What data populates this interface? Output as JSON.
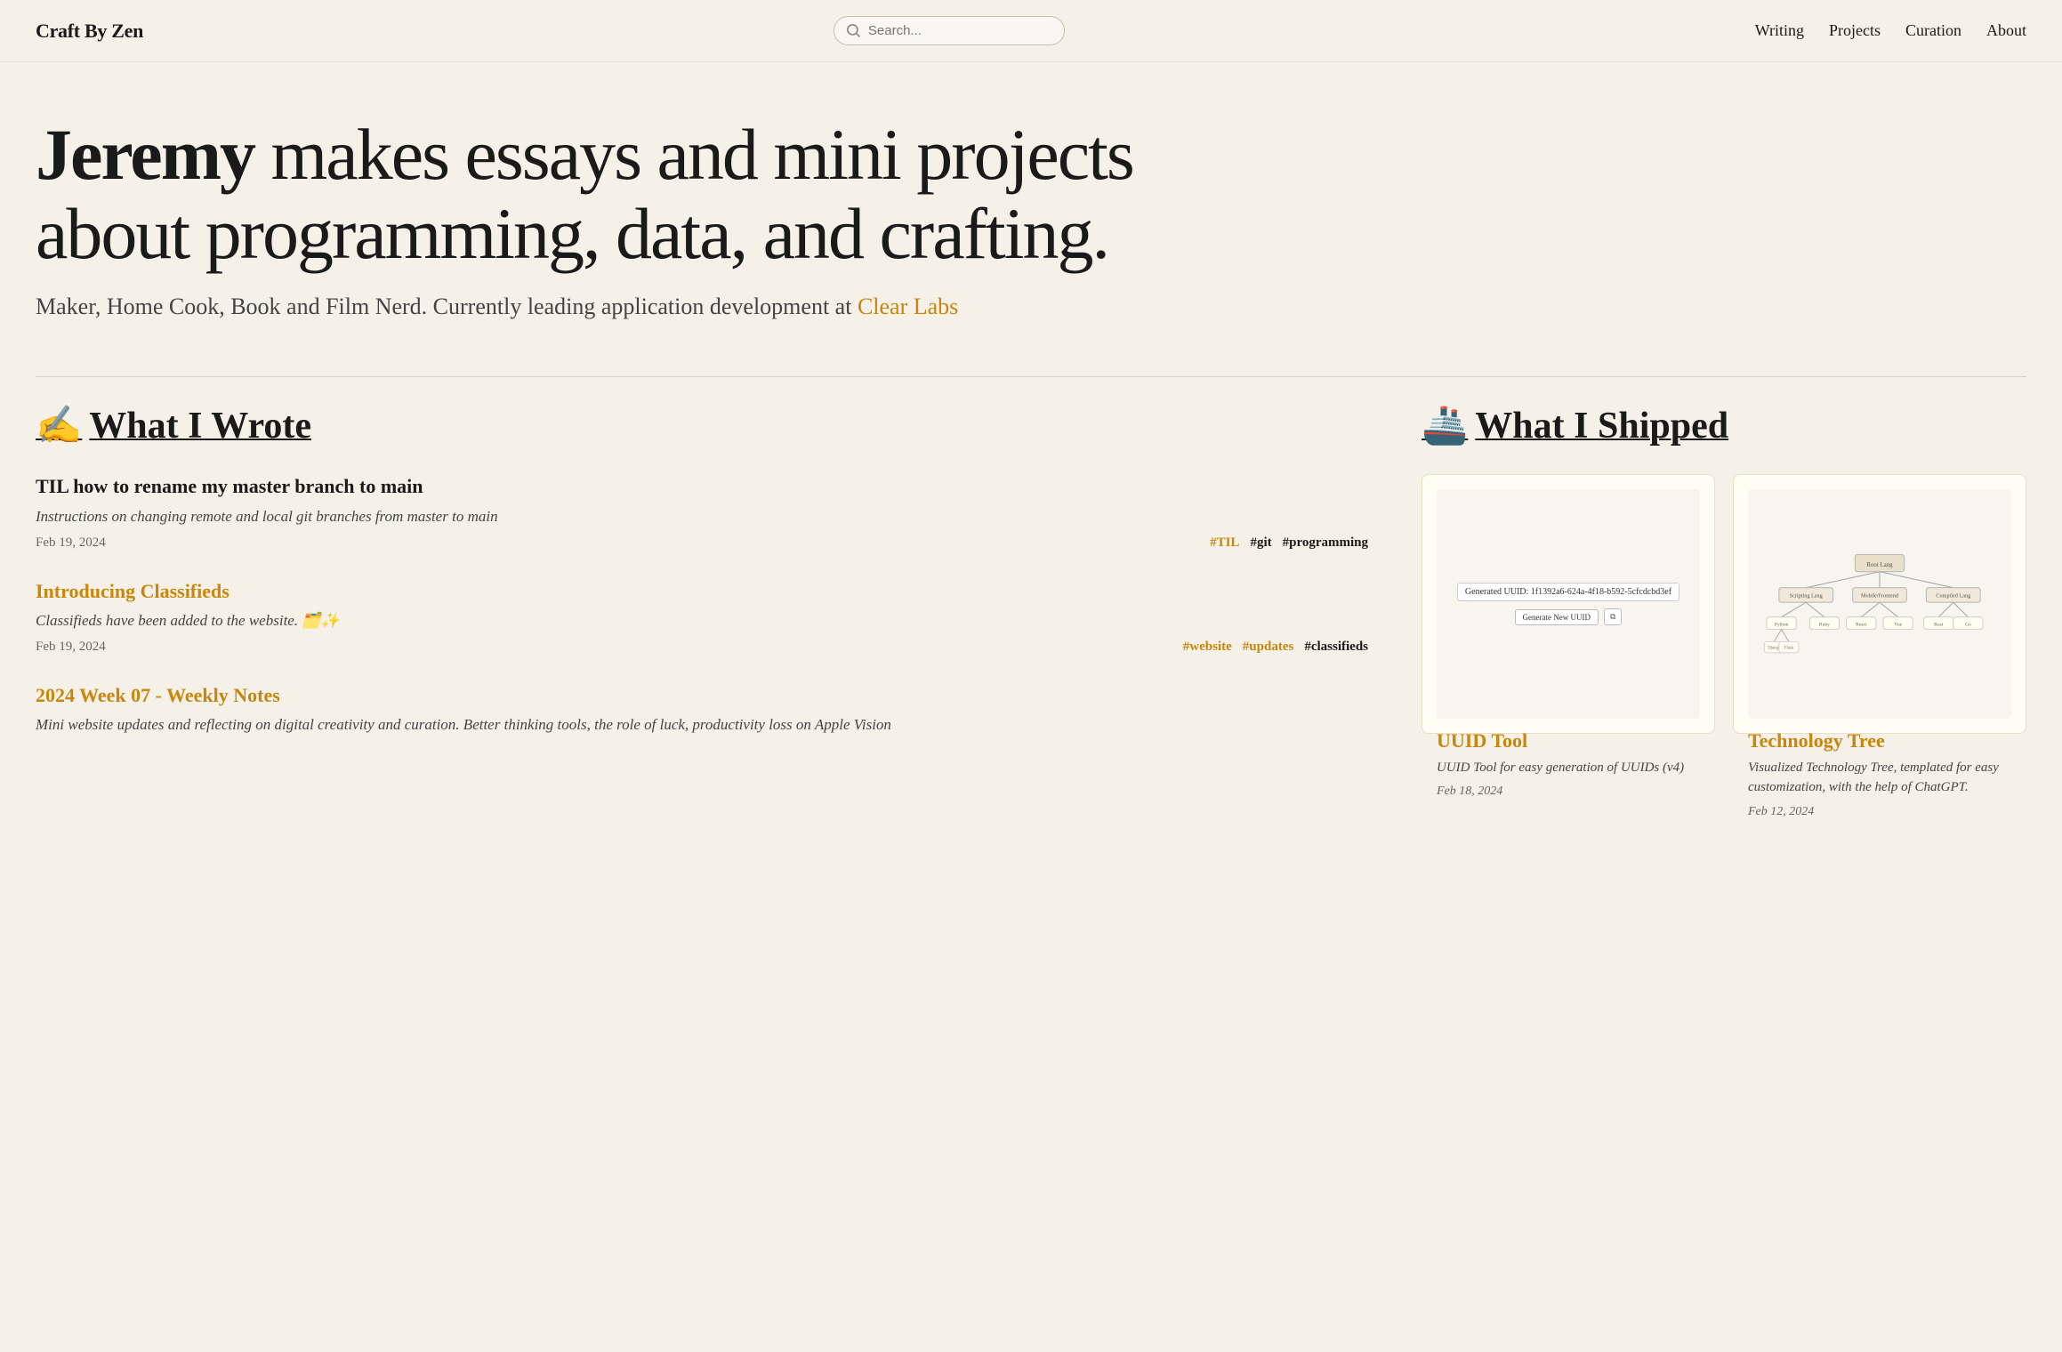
{
  "nav": {
    "logo": "Craft By Zen",
    "search_placeholder": "Search...",
    "links": [
      "Writing",
      "Projects",
      "Curation",
      "About"
    ]
  },
  "hero": {
    "title_bold": "Jeremy",
    "title_rest": " makes essays and mini projects about programming, data, and crafting.",
    "subtitle": "Maker, Home Cook, Book and Film Nerd. Currently leading application development at ",
    "subtitle_link": "Clear Labs"
  },
  "wrote_section": {
    "title_emoji": "✍️",
    "title_text": "What I Wrote",
    "items": [
      {
        "title": "TIL how to rename my master branch to main",
        "title_type": "plain",
        "desc": "Instructions on changing remote and local git branches from master to main",
        "date": "Feb 19, 2024",
        "tags": [
          "#TIL",
          "#git",
          "#programming"
        ],
        "tag_types": [
          "accent",
          "dark",
          "dark"
        ]
      },
      {
        "title": "Introducing Classifieds",
        "title_type": "link",
        "desc": "Classifieds have been added to the website. 🗂️✨",
        "date": "Feb 19, 2024",
        "tags": [
          "#website",
          "#updates",
          "#classifieds"
        ],
        "tag_types": [
          "accent",
          "accent",
          "dark"
        ]
      },
      {
        "title": "2024 Week 07 - Weekly Notes",
        "title_type": "link",
        "desc": "Mini website updates and reflecting on digital creativity and curation. Better thinking tools, the role of luck, productivity loss on Apple Vision",
        "date": "",
        "tags": [],
        "tag_types": []
      }
    ]
  },
  "shipped_section": {
    "title_emoji": "🚢",
    "title_text": "What I Shipped",
    "cards": [
      {
        "name": "UUID Tool",
        "desc": "UUID Tool for easy generation of UUIDs (v4)",
        "date": "Feb 18, 2024",
        "preview_type": "uuid",
        "uuid_value": "Generated UUID: 1f1392a6-624a-4f18-b592-5cfdcdb d3ef"
      },
      {
        "name": "Technology Tree",
        "desc": "Visualized Technology Tree, templated for easy customization, with the help of ChatGPT.",
        "date": "Feb 12, 2024",
        "preview_type": "techtree"
      }
    ]
  }
}
